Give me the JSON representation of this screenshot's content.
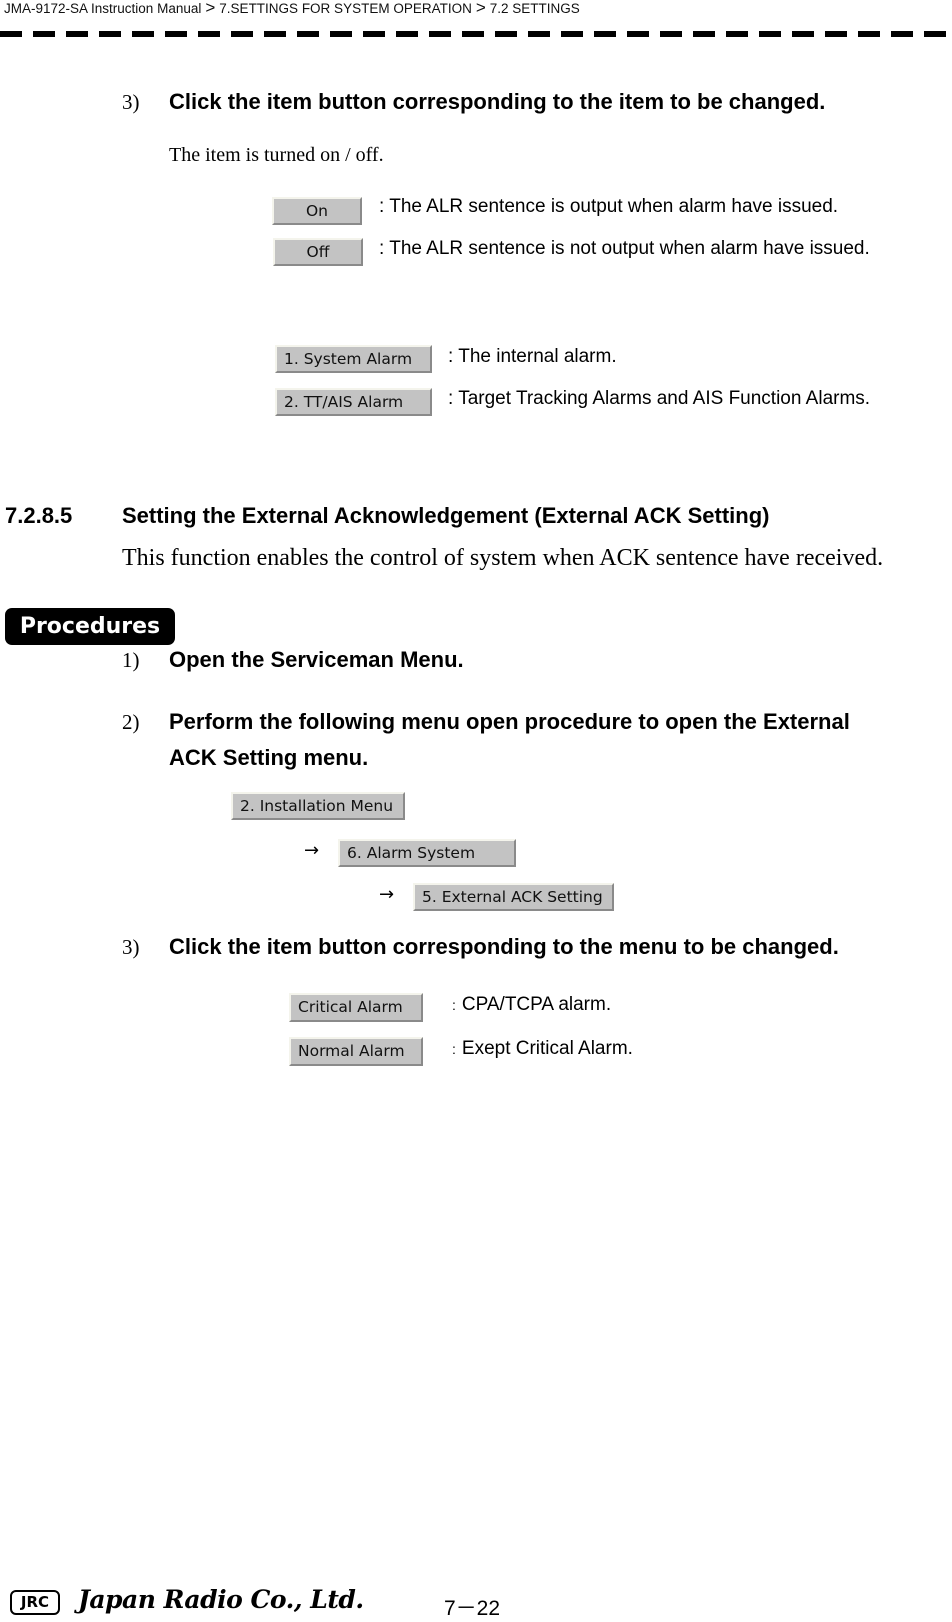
{
  "header": {
    "breadcrumb": [
      "JMA-9172-SA Instruction Manual",
      "7.SETTINGS FOR SYSTEM OPERATION",
      "7.2  SETTINGS"
    ],
    "separator": ">"
  },
  "part1": {
    "step3": {
      "number": "3)",
      "text": "Click the item button corresponding to the item to be changed."
    },
    "note": "The item is turned on / off.",
    "toggle_options": [
      {
        "button": "On",
        "description": ": The ALR sentence is output when alarm have issued."
      },
      {
        "button": "Off",
        "description": ": The ALR sentence is not output when alarm have issued."
      }
    ],
    "alarm_options": [
      {
        "button": "1. System Alarm",
        "description": ": The internal alarm."
      },
      {
        "button": "2. TT/AIS Alarm",
        "description": ": Target Tracking Alarms and AIS Function Alarms."
      }
    ]
  },
  "section": {
    "number": "7.2.8.5",
    "title": "Setting the External Acknowledgement (External ACK Setting)",
    "description": "This function enables the control of system when ACK sentence have received."
  },
  "procedures": {
    "badge": "Procedures",
    "steps": [
      {
        "number": "1)",
        "text": "Open the Serviceman Menu."
      },
      {
        "number": "2)",
        "text_line1": "Perform the following menu open procedure to open the External",
        "text_line2": "ACK Setting menu."
      },
      {
        "number": "3)",
        "text": "Click the item button corresponding to the menu to be changed."
      }
    ],
    "menu_path": {
      "arrow": "→",
      "buttons": [
        "2. Installation Menu",
        "6. Alarm System",
        "5. External ACK Setting"
      ]
    },
    "menu_options": [
      {
        "button": "Critical Alarm",
        "separator": ":",
        "description": "CPA/TCPA alarm."
      },
      {
        "button": "Normal Alarm",
        "separator": ":",
        "description": "Exept Critical Alarm."
      }
    ]
  },
  "footer": {
    "logo": "JRC",
    "company": "Japan Radio Co., Ltd.",
    "page": "7－22"
  }
}
